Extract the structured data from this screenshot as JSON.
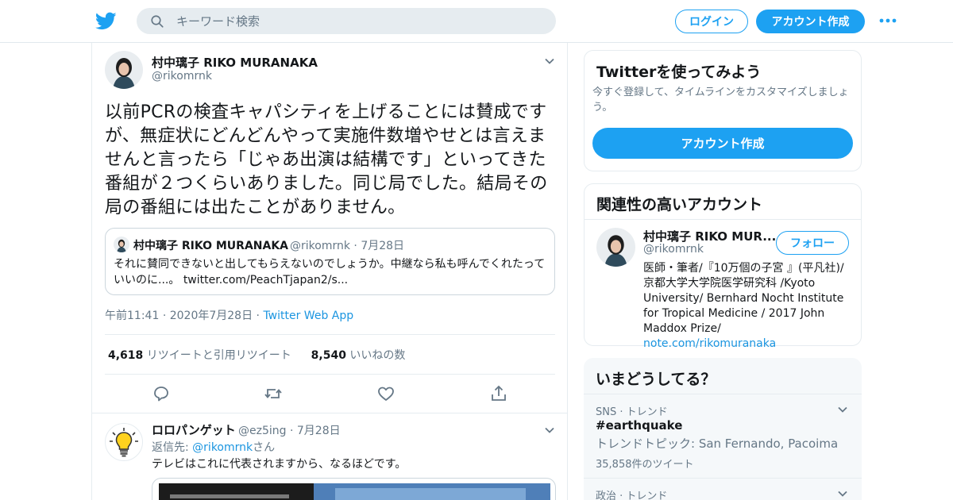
{
  "header": {
    "search_placeholder": "キーワード検索",
    "login_label": "ログイン",
    "signup_label": "アカウント作成"
  },
  "tweet": {
    "author_name": "村中璃子 RIKO MURANAKA",
    "author_handle": "@rikomrnk",
    "text": "以前PCRの検査キャパシティを上げることには賛成ですが、無症状にどんどんやって実施件数増やせとは言えませんと言ったら「じゃあ出演は結構です」といってきた番組が２つくらいありました。同じ局でした。結局その局の番組には出たことがありません。",
    "quote": {
      "author_name": "村中璃子 RIKO MURANAKA",
      "author_handle": "@rikomrnk",
      "date": "7月28日",
      "text": "それに賛同できないと出してもらえないのでしょうか。中継なら私も呼んでくれたっていいのに...。",
      "link": "twitter.com/PeachTjapan2/s..."
    },
    "time": "午前11:41",
    "date": "2020年7月28日",
    "source": "Twitter Web App",
    "retweets_count": "4,618",
    "retweets_label": "リツイートと引用リツイート",
    "likes_count": "8,540",
    "likes_label": "いいねの数"
  },
  "reply": {
    "author_name": "ロロパンゲット",
    "author_handle": "@ez5ing",
    "date": "7月28日",
    "reply_to_prefix": "返信先:",
    "reply_to_handle": "@rikomrnk",
    "reply_to_suffix": "さん",
    "text": "テレビはこれに代表されますから、なるほどです。"
  },
  "sidebar": {
    "signup_card": {
      "title": "Twitterを使ってみよう",
      "description": "今すぐ登録して、タイムラインをカスタマイズしましょう。",
      "button_label": "アカウント作成"
    },
    "related_card": {
      "title": "関連性の高いアカウント",
      "name": "村中璃子 RIKO MUR...",
      "handle": "@rikomrnk",
      "follow_label": "フォロー",
      "bio": "医師・筆者/『10万個の子宮 』(平凡社)/京都大学大学院医学研究科 /Kyoto University/ Bernhard Nocht Institute for Tropical Medicine / 2017 John Maddox Prize/",
      "bio_link": "note.com/rikomuranaka"
    },
    "trends": {
      "title": "いまどうしてる？",
      "items": [
        {
          "context": "SNS · トレンド",
          "name": "#earthquake",
          "description": "トレンドトピック: San Fernando, Pacoima",
          "count": "35,858件のツイート"
        },
        {
          "context": "政治 · トレンド"
        }
      ]
    }
  },
  "colors": {
    "accent": "#1da1f2",
    "link": "#1b95e0",
    "muted": "#657786",
    "border": "#e6ecf0"
  },
  "icons": [
    "twitter-bird-icon",
    "search-icon",
    "more-icon",
    "chevron-down-icon",
    "reply-icon",
    "retweet-icon",
    "like-icon",
    "share-icon",
    "lightbulb-icon"
  ]
}
